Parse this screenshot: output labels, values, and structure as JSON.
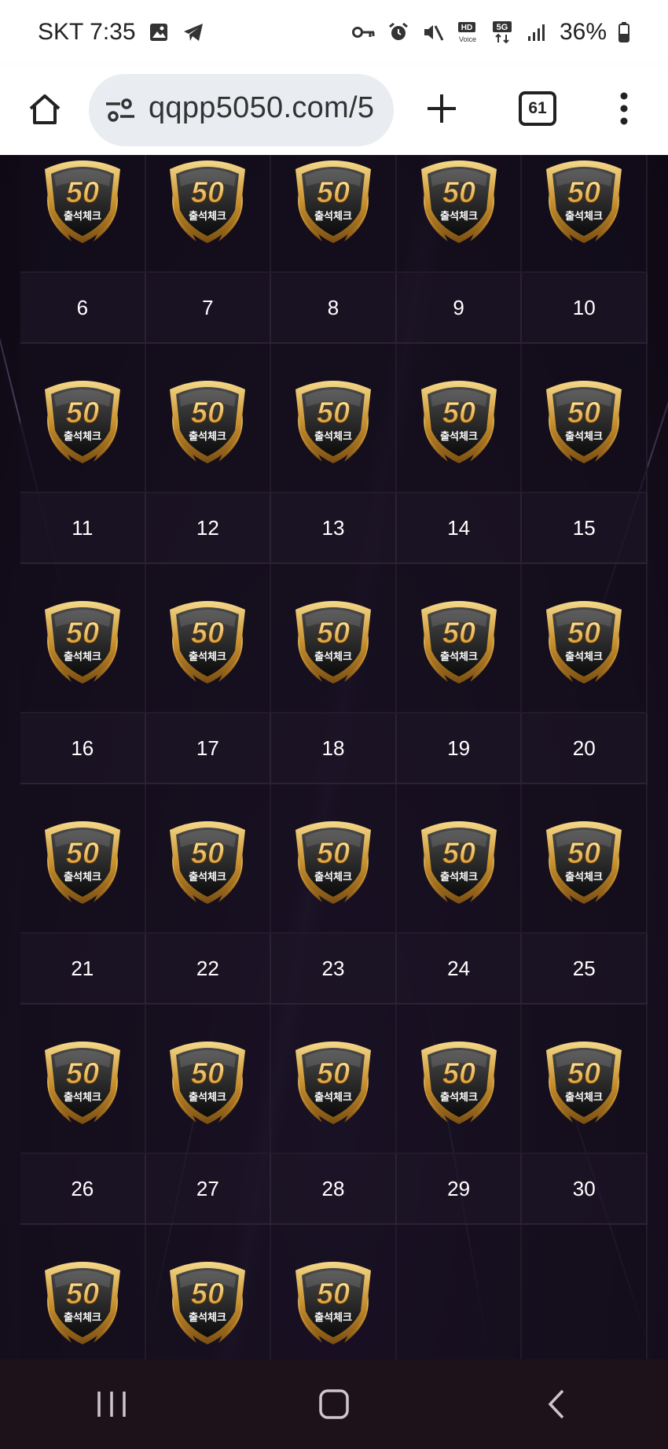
{
  "status_bar": {
    "carrier_time": "SKT 7:35",
    "battery": "36%",
    "left_icons": [
      "gallery-icon",
      "telegram-icon"
    ],
    "right_icons": [
      "vpn-key-icon",
      "alarm-icon",
      "mute-icon",
      "hd-voice-icon",
      "5g-icon",
      "signal-icon",
      "battery-icon"
    ]
  },
  "browser": {
    "url": "qqpp5050.com/5",
    "tab_count": "61"
  },
  "calendar": {
    "badge_label": "출석체크",
    "badge_number": "50",
    "weeks": [
      {
        "days": [
          "6",
          "7",
          "8",
          "9",
          "10"
        ],
        "stamped": [
          true,
          true,
          true,
          true,
          true
        ]
      },
      {
        "days": [
          "11",
          "12",
          "13",
          "14",
          "15"
        ],
        "stamped": [
          true,
          true,
          true,
          true,
          true
        ]
      },
      {
        "days": [
          "16",
          "17",
          "18",
          "19",
          "20"
        ],
        "stamped": [
          true,
          true,
          true,
          true,
          true
        ]
      },
      {
        "days": [
          "21",
          "22",
          "23",
          "24",
          "25"
        ],
        "stamped": [
          true,
          true,
          true,
          true,
          true
        ]
      },
      {
        "days": [
          "26",
          "27",
          "28",
          "29",
          "30"
        ],
        "stamped": [
          true,
          true,
          true,
          false,
          false
        ]
      }
    ],
    "top_partial_row_stamped": [
      true,
      true,
      true,
      true,
      true
    ]
  },
  "colors": {
    "fab": "#6b1fa6",
    "nav_bar": "#1d1219",
    "gold": "#d9a441"
  }
}
